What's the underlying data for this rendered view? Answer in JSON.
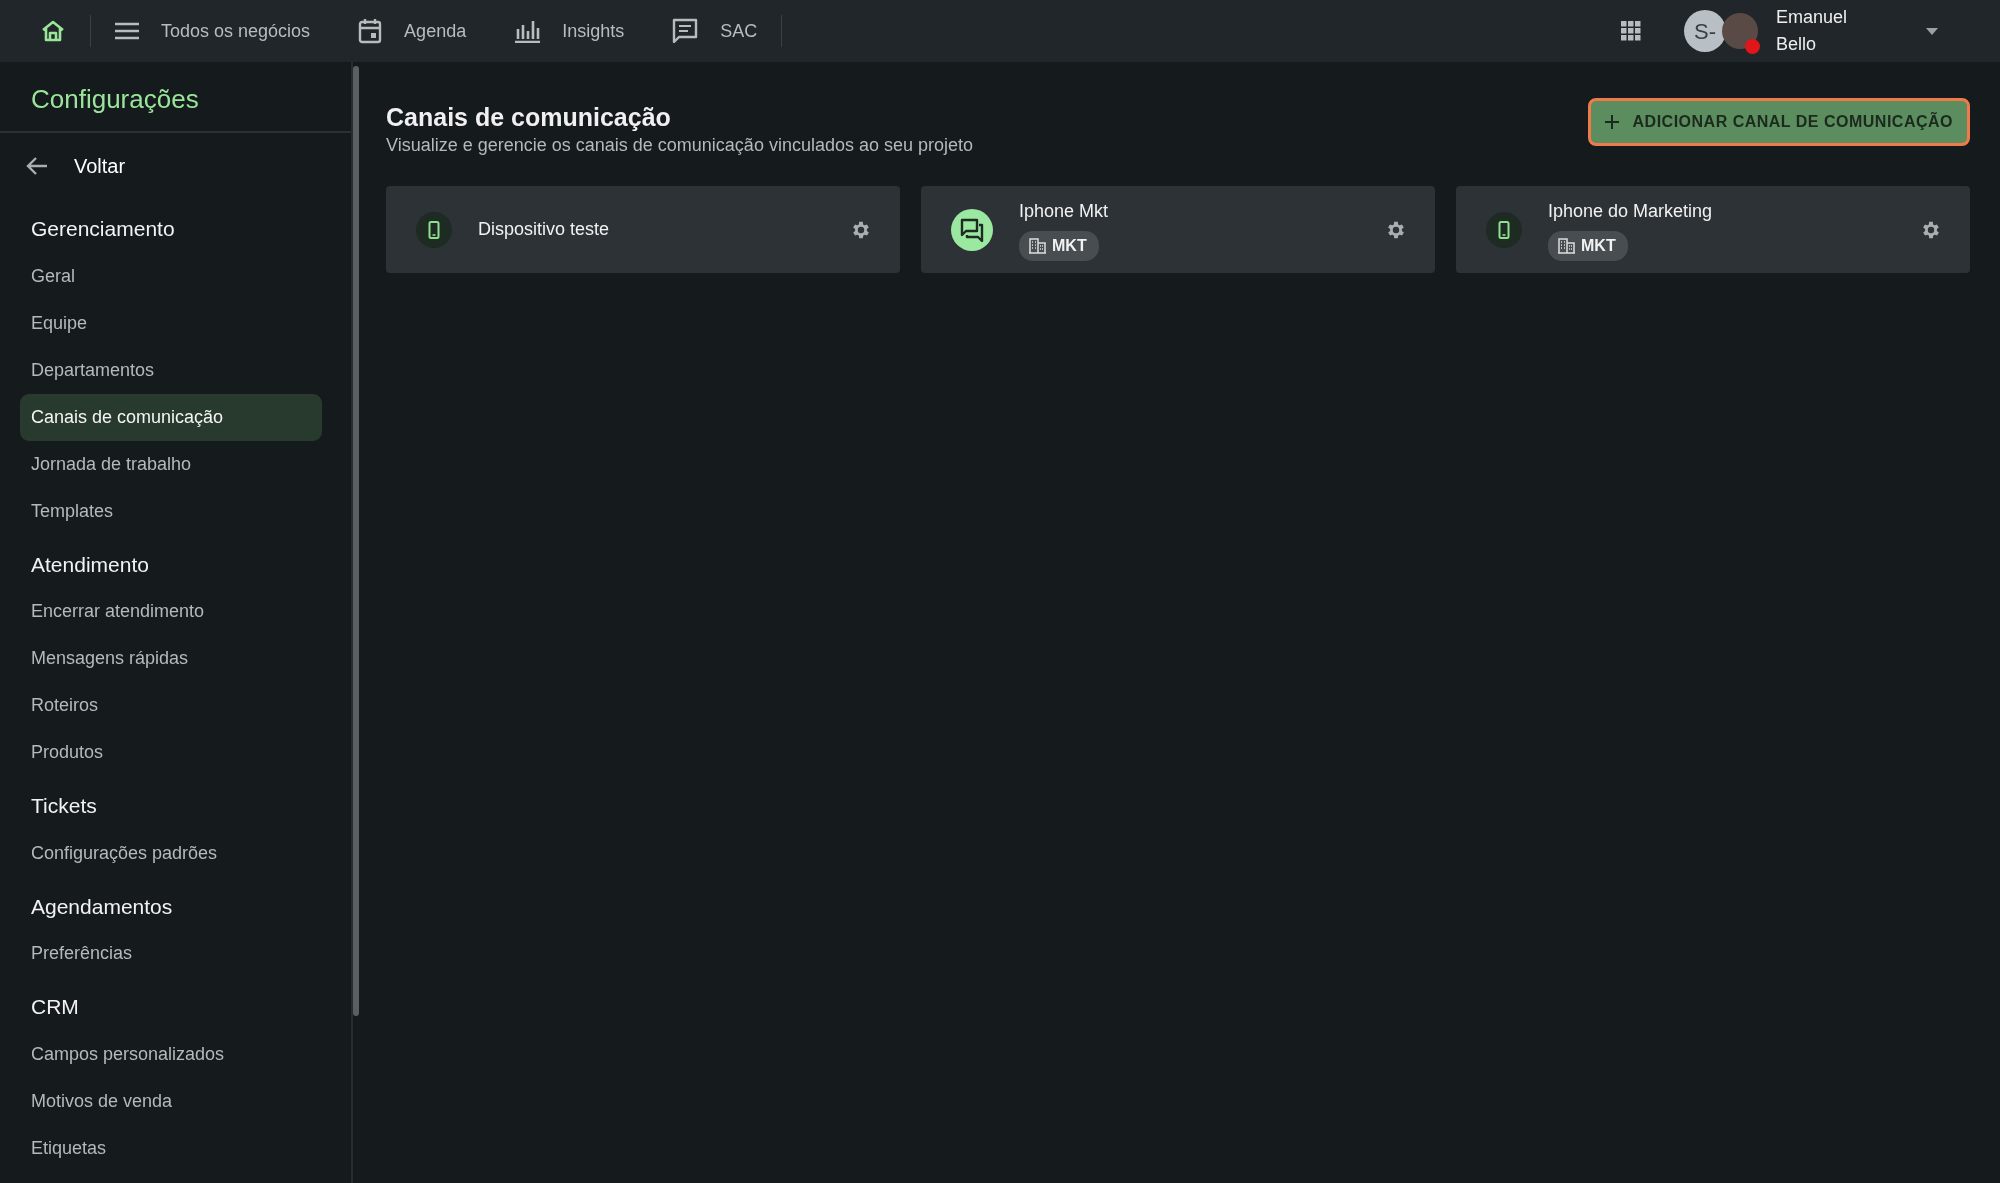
{
  "topbar": {
    "nav": [
      {
        "kind": "home"
      },
      {
        "kind": "menu",
        "label": "Todos os negócios"
      },
      {
        "kind": "calendar",
        "label": "Agenda"
      },
      {
        "kind": "chart",
        "label": "Insights"
      },
      {
        "kind": "chat",
        "label": "SAC"
      }
    ],
    "user": {
      "initials": "S-",
      "name": "Emanuel Bello",
      "online": false
    }
  },
  "sidebar": {
    "title": "Configurações",
    "back": "Voltar",
    "groups": [
      {
        "heading": "Gerenciamento",
        "items": [
          {
            "label": "Geral",
            "selected": false
          },
          {
            "label": "Equipe",
            "selected": false
          },
          {
            "label": "Departamentos",
            "selected": false
          },
          {
            "label": "Canais de comunicação",
            "selected": true
          },
          {
            "label": "Jornada de trabalho",
            "selected": false
          },
          {
            "label": "Templates",
            "selected": false
          }
        ]
      },
      {
        "heading": "Atendimento",
        "items": [
          {
            "label": "Encerrar atendimento",
            "selected": false
          },
          {
            "label": "Mensagens rápidas",
            "selected": false
          },
          {
            "label": "Roteiros",
            "selected": false
          },
          {
            "label": "Produtos",
            "selected": false
          }
        ]
      },
      {
        "heading": "Tickets",
        "items": [
          {
            "label": "Configurações padrões",
            "selected": false
          }
        ]
      },
      {
        "heading": "Agendamentos",
        "items": [
          {
            "label": "Preferências",
            "selected": false
          }
        ]
      },
      {
        "heading": "CRM",
        "items": [
          {
            "label": "Campos personalizados",
            "selected": false
          },
          {
            "label": "Motivos de venda",
            "selected": false
          },
          {
            "label": "Etiquetas",
            "selected": false
          }
        ]
      }
    ]
  },
  "page": {
    "title": "Canais de comunicação",
    "subtitle": "Visualize e gerencie os canais de comunicação vinculados ao seu projeto",
    "add_button": "ADICIONAR CANAL DE COMUNICAÇÃO"
  },
  "channels": [
    {
      "kind": "device",
      "name": "Dispositivo teste"
    },
    {
      "kind": "chat",
      "name": "Iphone Mkt",
      "tag": "MKT"
    },
    {
      "kind": "device",
      "name": "Iphone do Marketing",
      "tag": "MKT"
    }
  ]
}
